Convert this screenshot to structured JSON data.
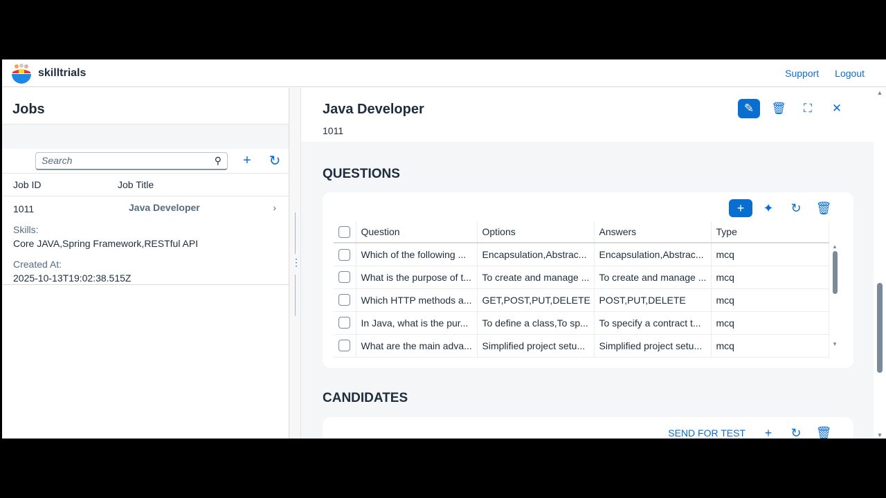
{
  "shell": {
    "brand": "skilltrials",
    "links": [
      "Support",
      "Logout"
    ]
  },
  "jobs": {
    "title": "Jobs",
    "search_placeholder": "Search",
    "columns": [
      "Job ID",
      "Job Title"
    ],
    "items": [
      {
        "id": "1011",
        "title": "Java Developer",
        "skills_label": "Skills:",
        "skills": "Core JAVA,Spring Framework,RESTful API",
        "created_label": "Created At:",
        "created": "2025-10-13T19:02:38.515Z"
      }
    ]
  },
  "detail": {
    "title": "Java Developer",
    "id": "1011",
    "questions": {
      "heading": "QUESTIONS",
      "columns": [
        "Question",
        "Options",
        "Answers",
        "Type"
      ],
      "rows": [
        [
          "Which of the following ...",
          "Encapsulation,Abstrac...",
          "Encapsulation,Abstrac...",
          "mcq"
        ],
        [
          "What is the purpose of t...",
          "To create and manage ...",
          "To create and manage ...",
          "mcq"
        ],
        [
          "Which HTTP methods a...",
          "GET,POST,PUT,DELETE",
          "POST,PUT,DELETE",
          "mcq"
        ],
        [
          "In Java, what is the pur...",
          "To define a class,To sp...",
          "To specify a contract t...",
          "mcq"
        ],
        [
          "What are the main adva...",
          "Simplified project setu...",
          "Simplified project setu...",
          "mcq"
        ]
      ]
    },
    "candidates": {
      "heading": "CANDIDATES",
      "send_label": "SEND FOR TEST"
    }
  },
  "colors": {
    "accent": "#0a6ed1"
  }
}
